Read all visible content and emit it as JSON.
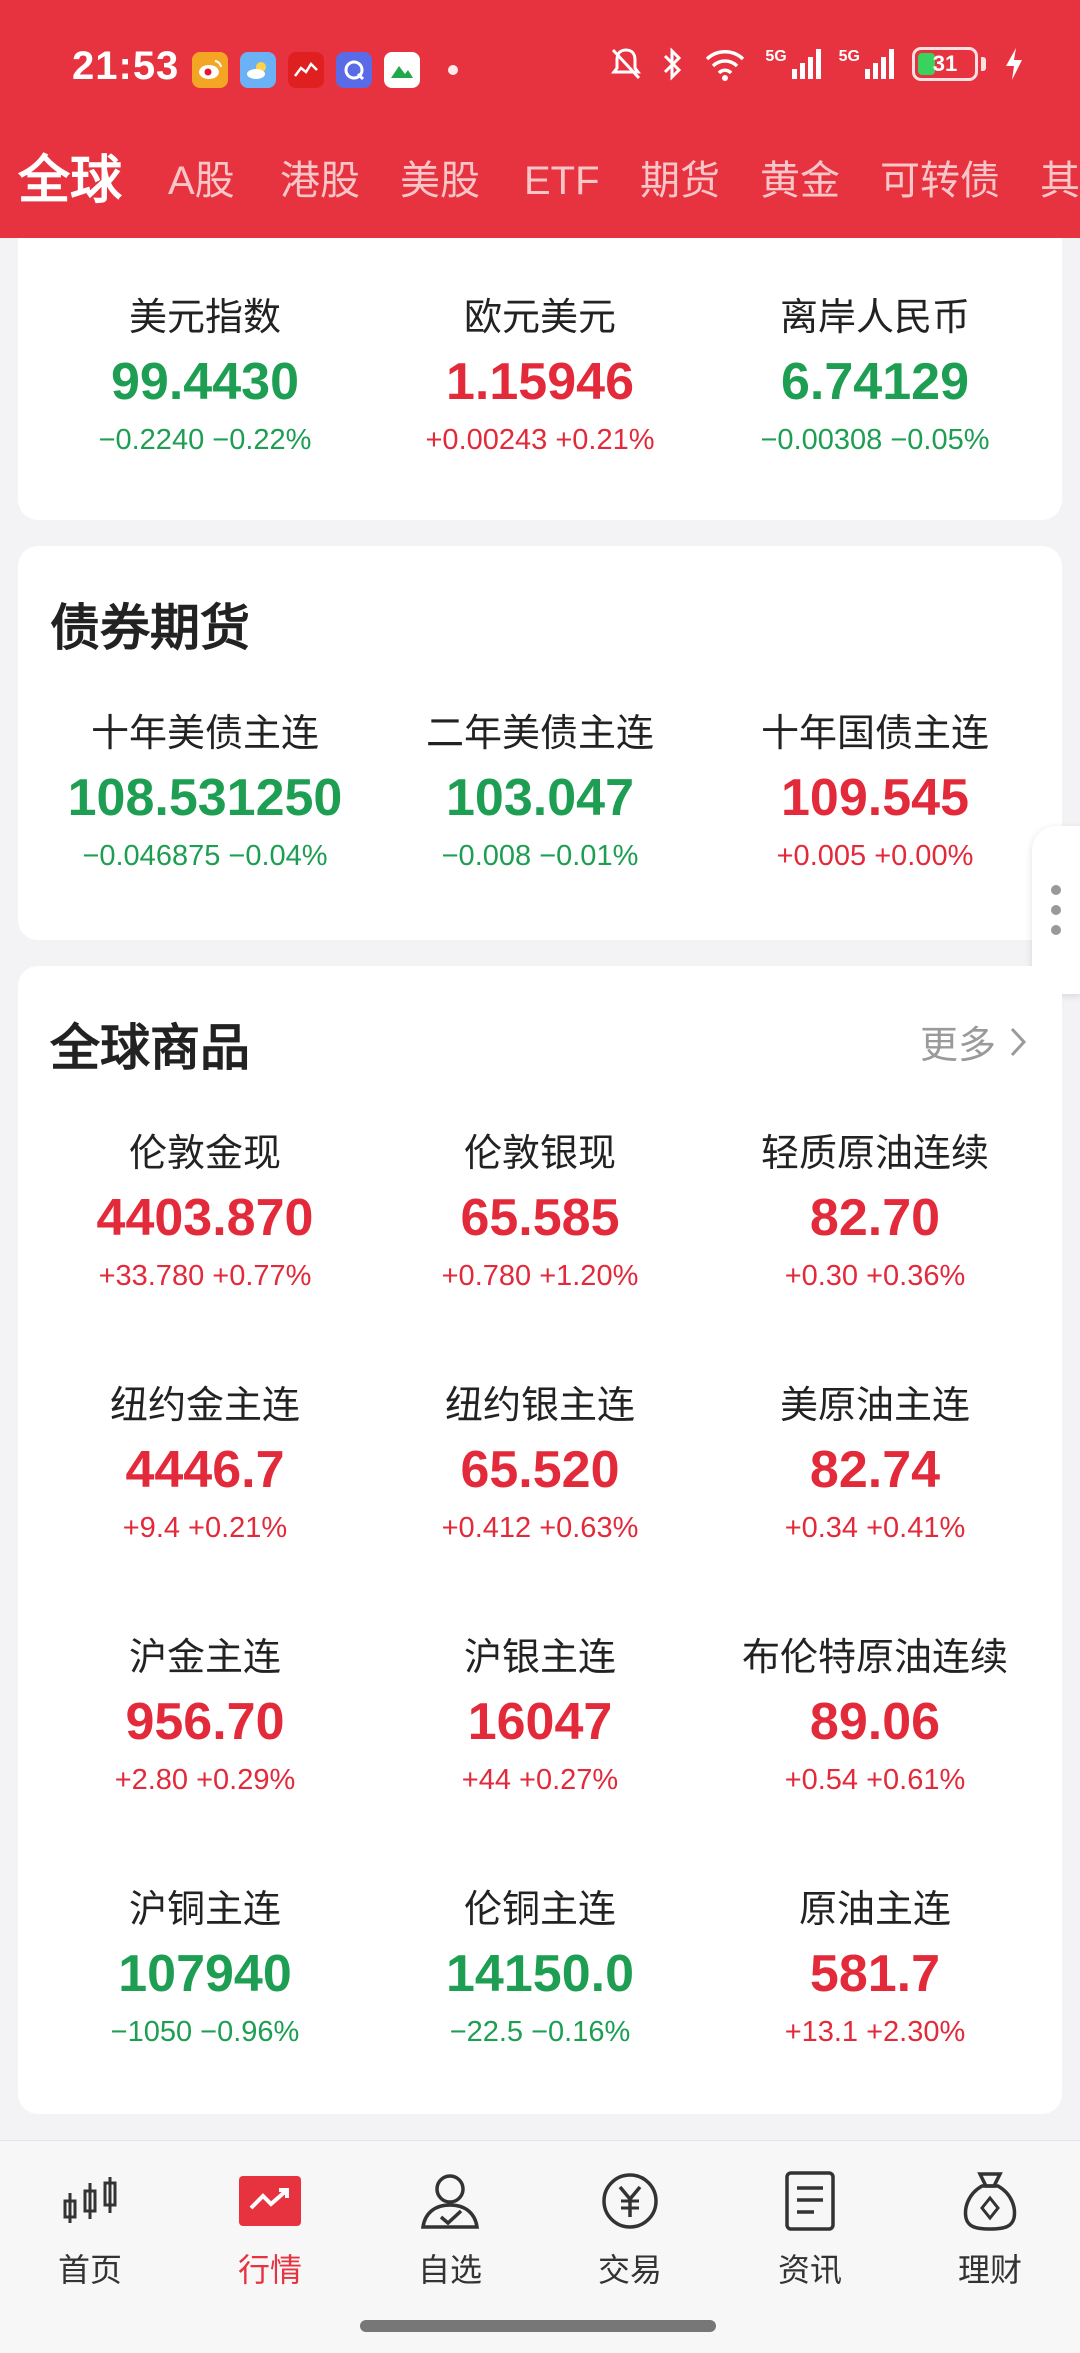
{
  "status": {
    "time": "21:53",
    "battery_level": "31",
    "signal_labels": [
      "5G",
      "5G"
    ]
  },
  "tabs": [
    "全球",
    "A股",
    "港股",
    "美股",
    "ETF",
    "期货",
    "黄金",
    "可转债",
    "其"
  ],
  "currency": {
    "items": [
      {
        "name": "美元指数",
        "price": "99.4430",
        "change": "−0.2240  −0.22%",
        "trend": "down"
      },
      {
        "name": "欧元美元",
        "price": "1.15946",
        "change": "+0.00243  +0.21%",
        "trend": "up"
      },
      {
        "name": "离岸人民币",
        "price": "6.74129",
        "change": "−0.00308  −0.05%",
        "trend": "down"
      }
    ]
  },
  "bonds": {
    "title": "债券期货",
    "items": [
      {
        "name": "十年美债主连",
        "price": "108.531250",
        "change": "−0.046875  −0.04%",
        "trend": "down"
      },
      {
        "name": "二年美债主连",
        "price": "103.047",
        "change": "−0.008  −0.01%",
        "trend": "down"
      },
      {
        "name": "十年国债主连",
        "price": "109.545",
        "change": "+0.005  +0.00%",
        "trend": "up"
      }
    ]
  },
  "commodities": {
    "title": "全球商品",
    "more_label": "更多",
    "items": [
      {
        "name": "伦敦金现",
        "price": "4403.870",
        "change": "+33.780  +0.77%",
        "trend": "up"
      },
      {
        "name": "伦敦银现",
        "price": "65.585",
        "change": "+0.780  +1.20%",
        "trend": "up"
      },
      {
        "name": "轻质原油连续",
        "price": "82.70",
        "change": "+0.30  +0.36%",
        "trend": "up"
      },
      {
        "name": "纽约金主连",
        "price": "4446.7",
        "change": "+9.4  +0.21%",
        "trend": "up"
      },
      {
        "name": "纽约银主连",
        "price": "65.520",
        "change": "+0.412  +0.63%",
        "trend": "up"
      },
      {
        "name": "美原油主连",
        "price": "82.74",
        "change": "+0.34  +0.41%",
        "trend": "up"
      },
      {
        "name": "沪金主连",
        "price": "956.70",
        "change": "+2.80  +0.29%",
        "trend": "up"
      },
      {
        "name": "沪银主连",
        "price": "16047",
        "change": "+44  +0.27%",
        "trend": "up"
      },
      {
        "name": "布伦特原油连续",
        "price": "89.06",
        "change": "+0.54  +0.61%",
        "trend": "up"
      },
      {
        "name": "沪铜主连",
        "price": "107940",
        "change": "−1050  −0.96%",
        "trend": "down"
      },
      {
        "name": "伦铜主连",
        "price": "14150.0",
        "change": "−22.5  −0.16%",
        "trend": "down"
      },
      {
        "name": "原油主连",
        "price": "581.7",
        "change": "+13.1  +2.30%",
        "trend": "up"
      }
    ]
  },
  "nav": [
    {
      "label": "首页",
      "icon": "candlestick-icon"
    },
    {
      "label": "行情",
      "icon": "market-chart-icon"
    },
    {
      "label": "自选",
      "icon": "user-check-icon"
    },
    {
      "label": "交易",
      "icon": "yen-coin-icon"
    },
    {
      "label": "资讯",
      "icon": "document-icon"
    },
    {
      "label": "理财",
      "icon": "money-bag-icon"
    }
  ],
  "colors": {
    "brand": "#e7333f",
    "up": "#e22a3a",
    "down": "#1e9e52"
  }
}
